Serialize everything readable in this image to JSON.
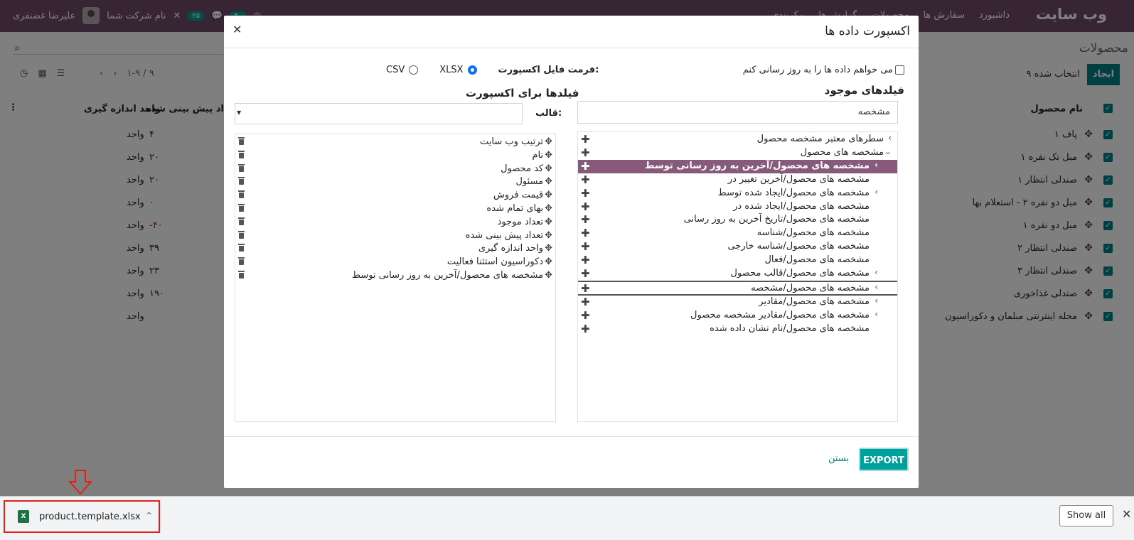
{
  "topbar": {
    "brand": "وب سایت",
    "menu": [
      "داشبورد",
      "سفارش ها",
      "محصولات",
      "گزارش ها",
      "پیکربندی"
    ],
    "company": "نام شرکت شما",
    "user": "علیرضا غضنفری",
    "badge_count": "۲۵",
    "clock": "۳۰"
  },
  "list": {
    "page_title": "محصولات",
    "create_label": "ایجاد",
    "selected_info": "۹ انتخاب شده",
    "pager": "۱-۹ / ۹",
    "headers": {
      "name": "نام محصول",
      "forecast": "تعداد پیش بینی شده",
      "uom": "واحد اندازه گیری"
    },
    "rows": [
      {
        "name": "پاف ۱",
        "qty": "۴",
        "uom": "واحد",
        "neg": false
      },
      {
        "name": "مبل تک نفره ۱",
        "qty": "۲۰",
        "uom": "واحد",
        "neg": false
      },
      {
        "name": "صندلی انتظار ۱",
        "qty": "۲۰",
        "uom": "واحد",
        "neg": false
      },
      {
        "name": "مبل دو نفره ۲ - استعلام بها",
        "qty": "۰",
        "uom": "واحد",
        "neg": false
      },
      {
        "name": "مبل دو نفره ۱",
        "qty": "-۴۰",
        "uom": "واحد",
        "neg": true
      },
      {
        "name": "صندلی انتظار ۲",
        "qty": "۳۹",
        "uom": "واحد",
        "neg": false
      },
      {
        "name": "صندلی انتظار ۳",
        "qty": "۲۳",
        "uom": "واحد",
        "neg": false
      },
      {
        "name": "صندلی غذاخوری",
        "qty": "۱۹۰",
        "uom": "واحد",
        "neg": false
      },
      {
        "name": "مجله اینترنتی مبلمان و دکوراسیون",
        "qty": "",
        "uom": "واحد",
        "neg": false
      }
    ]
  },
  "modal": {
    "title": "اکسپورت داده ها",
    "update_checkbox": "می خواهم داده ها را به روز رسانی کنم",
    "format_label": "فرمت فایل اکسپورت:",
    "format_xlsx": "XLSX",
    "format_csv": "CSV",
    "available_heading": "فیلدهای موجود",
    "export_heading": "فیلدها برای اکسپورت",
    "search_value": "مشخصه",
    "template_label": "قالب:",
    "export_fields": [
      "ترتیب وب سایت",
      "نام",
      "کد محصول",
      "مسئول",
      "قیمت فروش",
      "بهای تمام شده",
      "تعداد موجود",
      "تعداد پیش بینی شده",
      "واحد اندازه گیری",
      "دکوراسیون استثنا فعالیت",
      "مشخصه های محصول/آخرین به روز رسانی توسط"
    ],
    "available_fields": [
      {
        "label": "سطرهای معتبر مشخصه محصول",
        "chev": "›",
        "level": 0
      },
      {
        "label": "مشخصه های محصول",
        "chev": "⌄",
        "level": 0
      },
      {
        "label": "مشخصه های محصول/آخرین به روز رسانی توسط",
        "chev": "›",
        "level": 1,
        "selected": true
      },
      {
        "label": "مشخصه های محصول/آخرین تغییر در",
        "chev": "",
        "level": 1
      },
      {
        "label": "مشخصه های محصول/ایجاد شده توسط",
        "chev": "›",
        "level": 1
      },
      {
        "label": "مشخصه های محصول/ایجاد شده در",
        "chev": "",
        "level": 1
      },
      {
        "label": "مشخصه های محصول/تاریخ آخرین به روز رسانی",
        "chev": "",
        "level": 1
      },
      {
        "label": "مشخصه های محصول/شناسه",
        "chev": "",
        "level": 1
      },
      {
        "label": "مشخصه های محصول/شناسه خارجی",
        "chev": "",
        "level": 1
      },
      {
        "label": "مشخصه های محصول/فعال",
        "chev": "",
        "level": 1
      },
      {
        "label": "مشخصه های محصول/قالب محصول",
        "chev": "›",
        "level": 1
      },
      {
        "label": "مشخصه های محصول/مشخصه",
        "chev": "›",
        "level": 1,
        "bordered": true
      },
      {
        "label": "مشخصه های محصول/مقادیر",
        "chev": "›",
        "level": 1
      },
      {
        "label": "مشخصه های محصول/مقادیر مشخصه محصول",
        "chev": "›",
        "level": 1
      },
      {
        "label": "مشخصه های محصول/نام نشان داده شده",
        "chev": "",
        "level": 1
      }
    ],
    "export_button": "EXPORT",
    "close_button": "بستن"
  },
  "download_bar": {
    "file_name": "product.template.xlsx",
    "show_all": "Show all"
  },
  "colors": {
    "navbar": "#714B67",
    "primary": "#00a09d",
    "selected_field": "#875A7B",
    "annotation": "#e0201b"
  }
}
